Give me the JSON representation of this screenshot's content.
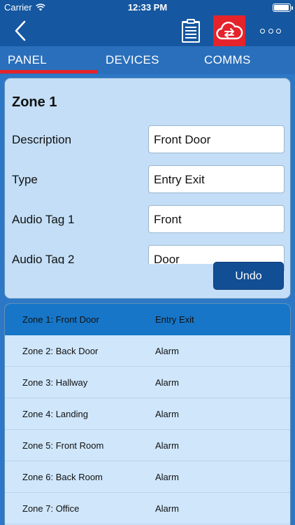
{
  "status": {
    "carrier": "Carrier",
    "time": "12:33 PM",
    "battery_level": 0.95
  },
  "nav": {
    "back_icon": "chevron-left-icon",
    "clipboard_icon": "clipboard-icon",
    "cloud_icon": "cloud-sync-icon",
    "more_icon": "more-icon"
  },
  "tabs": [
    {
      "label": "PANEL"
    },
    {
      "label": "DEVICES"
    },
    {
      "label": "COMMS"
    }
  ],
  "zone": {
    "title": "Zone 1",
    "fields": [
      {
        "label": "Description",
        "value": "Front Door"
      },
      {
        "label": "Type",
        "value": "Entry Exit"
      },
      {
        "label": "Audio Tag 1",
        "value": "Front"
      },
      {
        "label": "Audio Tag 2",
        "value": "Door"
      }
    ],
    "undo_label": "Undo"
  },
  "zones": [
    {
      "name": "Zone 1: Front Door",
      "type": "Entry Exit"
    },
    {
      "name": "Zone 2: Back Door",
      "type": "Alarm"
    },
    {
      "name": "Zone 3: Hallway",
      "type": "Alarm"
    },
    {
      "name": "Zone 4: Landing",
      "type": "Alarm"
    },
    {
      "name": "Zone 5: Front Room",
      "type": "Alarm"
    },
    {
      "name": "Zone 6: Back Room",
      "type": "Alarm"
    },
    {
      "name": "Zone 7: Office",
      "type": "Alarm"
    }
  ],
  "colors": {
    "accent": "#e5232b",
    "nav": "#1557a0",
    "selected_row": "#1776c8",
    "panel": "#c3def6"
  }
}
